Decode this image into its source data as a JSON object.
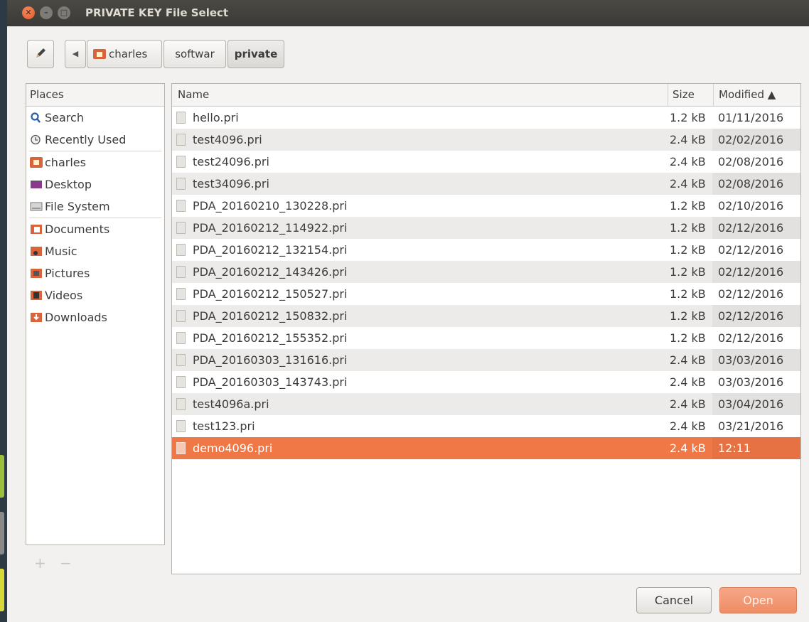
{
  "window": {
    "title": "PRIVATE KEY File Select"
  },
  "toolbar": {
    "breadcrumbs": [
      "charles",
      "softwar",
      "private"
    ]
  },
  "places": {
    "header": "Places",
    "items": [
      {
        "label": "Search",
        "icon": "search-icon"
      },
      {
        "label": "Recently Used",
        "icon": "clock-icon"
      },
      {
        "label": "charles",
        "icon": "home-folder-icon"
      },
      {
        "label": "Desktop",
        "icon": "desktop-icon"
      },
      {
        "label": "File System",
        "icon": "drive-icon"
      },
      {
        "label": "Documents",
        "icon": "documents-folder-icon"
      },
      {
        "label": "Music",
        "icon": "music-folder-icon"
      },
      {
        "label": "Pictures",
        "icon": "pictures-folder-icon"
      },
      {
        "label": "Videos",
        "icon": "videos-folder-icon"
      },
      {
        "label": "Downloads",
        "icon": "downloads-folder-icon"
      }
    ],
    "add_label": "+",
    "remove_label": "−"
  },
  "files": {
    "columns": {
      "name": "Name",
      "size": "Size",
      "modified": "Modified ▲"
    },
    "rows": [
      {
        "name": "hello.pri",
        "size": "1.2 kB",
        "modified": "01/11/2016"
      },
      {
        "name": "test4096.pri",
        "size": "2.4 kB",
        "modified": "02/02/2016"
      },
      {
        "name": "test24096.pri",
        "size": "2.4 kB",
        "modified": "02/08/2016"
      },
      {
        "name": "test34096.pri",
        "size": "2.4 kB",
        "modified": "02/08/2016"
      },
      {
        "name": "PDA_20160210_130228.pri",
        "size": "1.2 kB",
        "modified": "02/10/2016"
      },
      {
        "name": "PDA_20160212_114922.pri",
        "size": "1.2 kB",
        "modified": "02/12/2016"
      },
      {
        "name": "PDA_20160212_132154.pri",
        "size": "1.2 kB",
        "modified": "02/12/2016"
      },
      {
        "name": "PDA_20160212_143426.pri",
        "size": "1.2 kB",
        "modified": "02/12/2016"
      },
      {
        "name": "PDA_20160212_150527.pri",
        "size": "1.2 kB",
        "modified": "02/12/2016"
      },
      {
        "name": "PDA_20160212_150832.pri",
        "size": "1.2 kB",
        "modified": "02/12/2016"
      },
      {
        "name": "PDA_20160212_155352.pri",
        "size": "1.2 kB",
        "modified": "02/12/2016"
      },
      {
        "name": "PDA_20160303_131616.pri",
        "size": "2.4 kB",
        "modified": "03/03/2016"
      },
      {
        "name": "PDA_20160303_143743.pri",
        "size": "2.4 kB",
        "modified": "03/03/2016"
      },
      {
        "name": "test4096a.pri",
        "size": "2.4 kB",
        "modified": "03/04/2016"
      },
      {
        "name": "test123.pri",
        "size": "2.4 kB",
        "modified": "03/21/2016"
      },
      {
        "name": "demo4096.pri",
        "size": "2.4 kB",
        "modified": "12:11",
        "selected": true
      }
    ]
  },
  "buttons": {
    "cancel": "Cancel",
    "open": "Open"
  },
  "colors": {
    "accent": "#f07746",
    "titlebar": "#3c3b37"
  }
}
